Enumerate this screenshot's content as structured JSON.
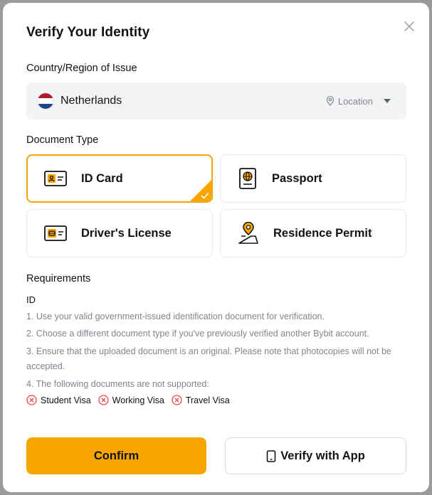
{
  "modal": {
    "title": "Verify Your Identity",
    "close_icon": "close-icon"
  },
  "country": {
    "label": "Country/Region of Issue",
    "selected": "Netherlands",
    "flag_icon": "netherlands-flag-icon",
    "location_label": "Location",
    "location_icon": "location-pin-icon",
    "dropdown_icon": "caret-down-icon"
  },
  "document_type": {
    "label": "Document Type",
    "options": [
      {
        "label": "ID Card",
        "icon": "id-card-icon",
        "selected": true
      },
      {
        "label": "Passport",
        "icon": "passport-icon",
        "selected": false
      },
      {
        "label": "Driver's License",
        "icon": "drivers-license-icon",
        "selected": false
      },
      {
        "label": "Residence Permit",
        "icon": "residence-permit-icon",
        "selected": false
      }
    ]
  },
  "requirements": {
    "label": "Requirements",
    "doc_name": "ID",
    "items": [
      "1. Use your valid government-issued identification document for verification.",
      "2. Choose a different document type if you've previously verified another Bybit account.",
      "3. Ensure that the uploaded document is an original. Please note that photocopies will not be accepted.",
      "4. The following documents are not supported:"
    ],
    "unsupported": [
      "Student Visa",
      "Working Visa",
      "Travel Visa"
    ]
  },
  "actions": {
    "confirm_label": "Confirm",
    "verify_app_label": "Verify with App",
    "phone_icon": "phone-icon"
  },
  "colors": {
    "accent": "#f7a600",
    "error": "#ef454a",
    "muted_text": "#81858c",
    "input_bg": "#f3f4f6"
  }
}
